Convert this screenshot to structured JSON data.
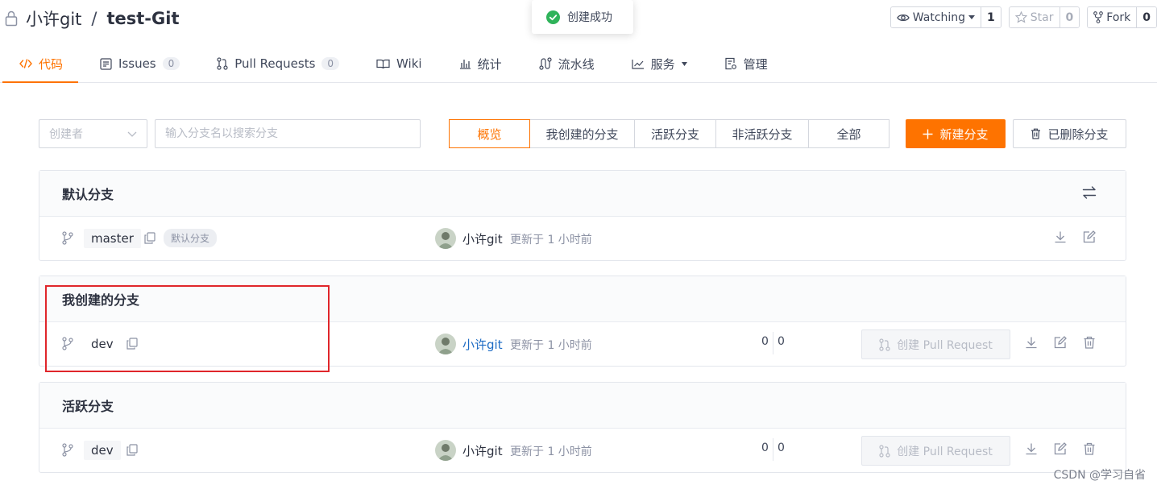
{
  "repo": {
    "owner": "小许git",
    "separator": "/",
    "name": "test-Git"
  },
  "header_actions": {
    "watch": {
      "label": "Watching",
      "count": "1"
    },
    "star": {
      "label": "Star",
      "count": "0"
    },
    "fork": {
      "label": "Fork",
      "count": "0"
    }
  },
  "toast": {
    "message": "创建成功"
  },
  "tabs": [
    {
      "label": "代码",
      "active": true
    },
    {
      "label": "Issues",
      "badge": "0"
    },
    {
      "label": "Pull Requests",
      "badge": "0"
    },
    {
      "label": "Wiki"
    },
    {
      "label": "统计"
    },
    {
      "label": "流水线"
    },
    {
      "label": "服务"
    },
    {
      "label": "管理"
    }
  ],
  "filters": {
    "creator_placeholder": "创建者",
    "search_placeholder": "输入分支名以搜索分支",
    "segments": [
      "概览",
      "我创建的分支",
      "活跃分支",
      "非活跃分支",
      "全部"
    ],
    "active_segment": "概览",
    "new_branch_label": "新建分支",
    "deleted_label": "已删除分支"
  },
  "sections": [
    {
      "title": "默认分支",
      "rows": [
        {
          "branch": "master",
          "tag": "默认分支",
          "author": "小许git",
          "updated": "更新于 1 小时前"
        }
      ]
    },
    {
      "title": "我创建的分支",
      "rows": [
        {
          "branch": "dev",
          "author": "小许git",
          "updated": "更新于 1 小时前",
          "ahead": "0",
          "behind": "0",
          "pr_label": "创建 Pull Request"
        }
      ]
    },
    {
      "title": "活跃分支",
      "rows": [
        {
          "branch": "dev",
          "author": "小许git",
          "updated": "更新于 1 小时前",
          "ahead": "0",
          "behind": "0",
          "pr_label": "创建 Pull Request"
        }
      ]
    }
  ],
  "watermark": "CSDN @学习自省",
  "colors": {
    "accent": "#fe7300",
    "link": "#1d6bc4",
    "success": "#2fb35a",
    "highlight": "#e0262b"
  }
}
